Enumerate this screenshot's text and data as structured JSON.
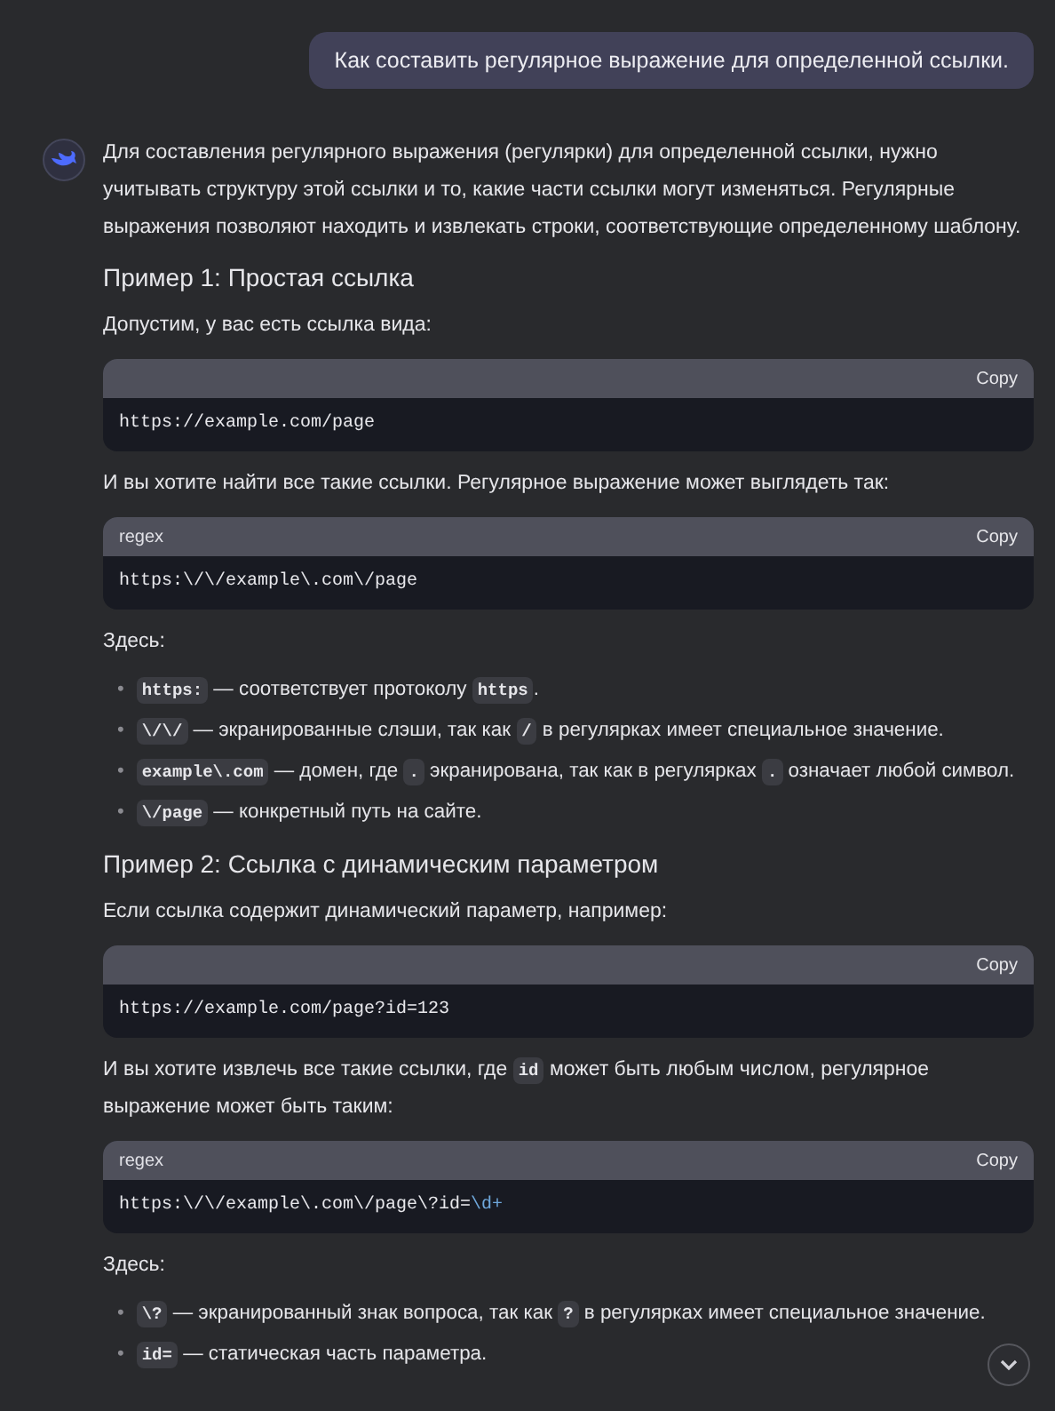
{
  "user_message": {
    "text": "Как составить регулярное выражение для определенной ссылки."
  },
  "answer": {
    "blocks": [
      {
        "kind": "paragraph",
        "segments": [
          {
            "text": "Для составления регулярного выражения (регулярки) для определенной ссылки, нужно учитывать структуру этой ссылки и то, какие части ссылки могут изменяться. Регулярные выражения позволяют находить и извлекать строки, соответствующие определенному шаблону.",
            "code": false
          }
        ]
      },
      {
        "kind": "heading",
        "text": "Пример 1: Простая ссылка"
      },
      {
        "kind": "paragraph",
        "segments": [
          {
            "text": "Допустим, у вас есть ссылка вида:",
            "code": false
          }
        ]
      },
      {
        "kind": "code",
        "copy": "Copy",
        "tokens": [
          {
            "text": "https://example.com/page",
            "kind": "plain"
          }
        ]
      },
      {
        "kind": "paragraph",
        "segments": [
          {
            "text": "И вы хотите найти все такие ссылки. Регулярное выражение может выглядеть так:",
            "code": false
          }
        ]
      },
      {
        "kind": "code",
        "language": "regex",
        "copy": "Copy",
        "tokens": [
          {
            "text": "https:\\/\\/example\\.com\\/page",
            "kind": "plain"
          }
        ]
      },
      {
        "kind": "paragraph",
        "segments": [
          {
            "text": "Здесь:",
            "code": false
          }
        ]
      },
      {
        "kind": "list",
        "marker": "•",
        "items": [
          [
            {
              "text": "https:",
              "code": true
            },
            {
              "text": " — соответствует протоколу ",
              "code": false
            },
            {
              "text": "https",
              "code": true
            },
            {
              "text": ".",
              "code": false
            }
          ],
          [
            {
              "text": "\\/\\/",
              "code": true
            },
            {
              "text": " — экранированные слэши, так как ",
              "code": false
            },
            {
              "text": "/",
              "code": true
            },
            {
              "text": " в регулярках имеет специальное значение.",
              "code": false
            }
          ],
          [
            {
              "text": "example\\.com",
              "code": true
            },
            {
              "text": " — домен, где ",
              "code": false
            },
            {
              "text": ".",
              "code": true
            },
            {
              "text": " экранирована, так как в регулярках ",
              "code": false
            },
            {
              "text": ".",
              "code": true
            },
            {
              "text": " означает любой символ.",
              "code": false
            }
          ],
          [
            {
              "text": "\\/page",
              "code": true
            },
            {
              "text": " — конкретный путь на сайте.",
              "code": false
            }
          ]
        ]
      },
      {
        "kind": "heading",
        "text": "Пример 2: Ссылка с динамическим параметром"
      },
      {
        "kind": "paragraph",
        "segments": [
          {
            "text": "Если ссылка содержит динамический параметр, например:",
            "code": false
          }
        ]
      },
      {
        "kind": "code",
        "copy": "Copy",
        "tokens": [
          {
            "text": "https://example.com/page?id=123",
            "kind": "plain"
          }
        ]
      },
      {
        "kind": "paragraph",
        "segments": [
          {
            "text": "И вы хотите извлечь все такие ссылки, где ",
            "code": false
          },
          {
            "text": "id",
            "code": true
          },
          {
            "text": " может быть любым числом, регулярное выражение может быть таким:",
            "code": false
          }
        ]
      },
      {
        "kind": "code",
        "language": "regex",
        "copy": "Copy",
        "tokens": [
          {
            "text": "https:\\/\\/example\\.com\\/page\\?id=",
            "kind": "plain"
          },
          {
            "text": "\\d+",
            "kind": "escape"
          }
        ]
      },
      {
        "kind": "paragraph",
        "segments": [
          {
            "text": "Здесь:",
            "code": false
          }
        ]
      },
      {
        "kind": "list",
        "marker": "•",
        "items": [
          [
            {
              "text": "\\?",
              "code": true
            },
            {
              "text": " — экранированный знак вопроса, так как ",
              "code": false
            },
            {
              "text": "?",
              "code": true
            },
            {
              "text": " в регулярках имеет специальное значение.",
              "code": false
            }
          ],
          [
            {
              "text": "id=",
              "code": true
            },
            {
              "text": " — статическая часть параметра.",
              "code": false
            }
          ]
        ]
      }
    ]
  }
}
